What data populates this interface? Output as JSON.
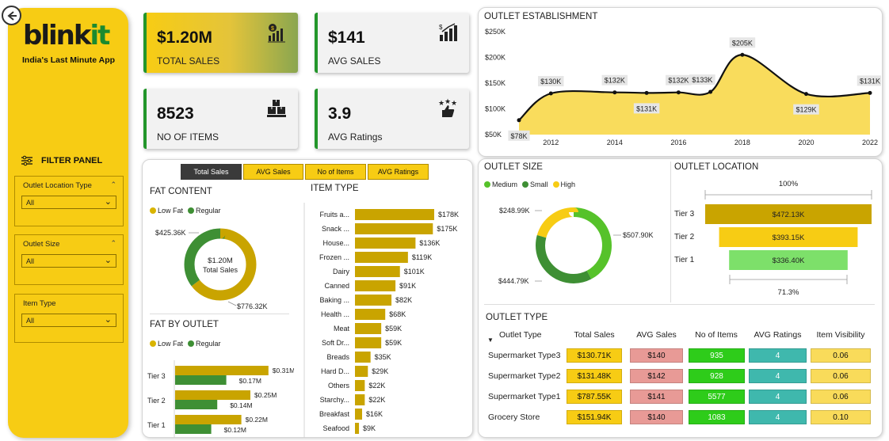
{
  "brand": {
    "logo_main": "blink",
    "logo_accent": "it",
    "tagline": "India's Last Minute App"
  },
  "filters": {
    "title": "FILTER PANEL",
    "items": [
      {
        "label": "Outlet Location Type",
        "value": "All"
      },
      {
        "label": "Outlet Size",
        "value": "All"
      },
      {
        "label": "Item Type",
        "value": "All"
      }
    ]
  },
  "kpis": [
    {
      "value": "$1.20M",
      "label": "TOTAL SALES",
      "icon": "money-bag-chart-icon"
    },
    {
      "value": "$141",
      "label": "AVG SALES",
      "icon": "dollar-bars-icon"
    },
    {
      "value": "8523",
      "label": "NO OF ITEMS",
      "icon": "boxes-stack-icon"
    },
    {
      "value": "3.9",
      "label": "AVG Ratings",
      "icon": "thumbs-up-stars-icon"
    }
  ],
  "tabs": [
    "Total Sales",
    "AVG Sales",
    "No of Items",
    "AVG Ratings"
  ],
  "active_tab": "Total Sales",
  "colors": {
    "yellow": "#f7cc14",
    "green_mid": "#3e8f34",
    "green_light": "#56c22a",
    "dark_gold": "#c9a400",
    "teal": "#3fb8ad",
    "pink": "#e89a96",
    "bright_green": "#2ecc1a"
  },
  "fat_content": {
    "title": "FAT CONTENT",
    "legend": [
      "Low Fat",
      "Regular"
    ],
    "center_value": "$1.20M",
    "center_label": "Total Sales",
    "low_fat_label": "$776.32K",
    "regular_label": "$425.36K",
    "chart_data": {
      "type": "pie",
      "categories": [
        "Low Fat",
        "Regular"
      ],
      "values": [
        776.32,
        425.36
      ]
    }
  },
  "fat_by_outlet": {
    "title": "FAT BY OUTLET",
    "legend": [
      "Low Fat",
      "Regular"
    ],
    "chart_data": {
      "type": "bar",
      "categories": [
        "Tier 3",
        "Tier 2",
        "Tier 1"
      ],
      "series": [
        {
          "name": "Low Fat",
          "values": [
            0.31,
            0.25,
            0.22
          ],
          "labels": [
            "$0.31M",
            "$0.25M",
            "$0.22M"
          ]
        },
        {
          "name": "Regular",
          "values": [
            0.17,
            0.14,
            0.12
          ],
          "labels": [
            "$0.17M",
            "$0.14M",
            "$0.12M"
          ]
        }
      ]
    }
  },
  "item_type": {
    "title": "ITEM TYPE",
    "chart_data": {
      "type": "bar",
      "categories": [
        "Fruits a...",
        "Snack ...",
        "House...",
        "Frozen ...",
        "Dairy",
        "Canned",
        "Baking ...",
        "Health ...",
        "Meat",
        "Soft Dr...",
        "Breads",
        "Hard D...",
        "Others",
        "Starchy...",
        "Breakfast",
        "Seafood"
      ],
      "values": [
        178,
        175,
        136,
        119,
        101,
        91,
        82,
        68,
        59,
        59,
        35,
        29,
        22,
        22,
        16,
        9
      ],
      "labels": [
        "$178K",
        "$175K",
        "$136K",
        "$119K",
        "$101K",
        "$91K",
        "$82K",
        "$68K",
        "$59K",
        "$59K",
        "$35K",
        "$29K",
        "$22K",
        "$22K",
        "$16K",
        "$9K"
      ]
    }
  },
  "establishment": {
    "title": "OUTLET ESTABLISHMENT",
    "chart_data": {
      "type": "area",
      "x": [
        2011,
        2012,
        2014,
        2015,
        2016,
        2017,
        2018,
        2020,
        2022
      ],
      "values": [
        78,
        130,
        132,
        131,
        132,
        133,
        205,
        129,
        131
      ],
      "labels": [
        "$78K",
        "$130K",
        "$132K",
        "$131K",
        "$132K",
        "$133K",
        "$205K",
        "$129K",
        "$131K"
      ],
      "xticks": [
        "2012",
        "2014",
        "2016",
        "2018",
        "2020",
        "2022"
      ],
      "yticks": [
        "$50K",
        "$100K",
        "$150K",
        "$200K",
        "$250K"
      ],
      "ylim": [
        50,
        250
      ]
    }
  },
  "outlet_size": {
    "title": "OUTLET SIZE",
    "legend": [
      "Medium",
      "Small",
      "High"
    ],
    "labels": [
      "$507.90K",
      "$444.79K",
      "$248.99K"
    ],
    "chart_data": {
      "type": "pie",
      "categories": [
        "Medium",
        "Small",
        "High"
      ],
      "values": [
        507.9,
        444.79,
        248.99
      ]
    }
  },
  "outlet_location": {
    "title": "OUTLET LOCATION",
    "top_pct": "100%",
    "bottom_pct": "71.3%",
    "chart_data": {
      "type": "bar",
      "categories": [
        "Tier 3",
        "Tier 2",
        "Tier 1"
      ],
      "values": [
        472.13,
        393.15,
        336.4
      ],
      "labels": [
        "$472.13K",
        "$393.15K",
        "$336.40K"
      ]
    }
  },
  "outlet_type": {
    "title": "OUTLET TYPE",
    "columns": [
      "Outlet Type",
      "Total Sales",
      "AVG Sales",
      "No of Items",
      "AVG Ratings",
      "Item Visibility"
    ],
    "rows": [
      [
        "Supermarket Type3",
        "$130.71K",
        "$140",
        "935",
        "4",
        "0.06"
      ],
      [
        "Supermarket Type2",
        "$131.48K",
        "$142",
        "928",
        "4",
        "0.06"
      ],
      [
        "Supermarket Type1",
        "$787.55K",
        "$141",
        "5577",
        "4",
        "0.06"
      ],
      [
        "Grocery Store",
        "$151.94K",
        "$140",
        "1083",
        "4",
        "0.10"
      ]
    ]
  }
}
